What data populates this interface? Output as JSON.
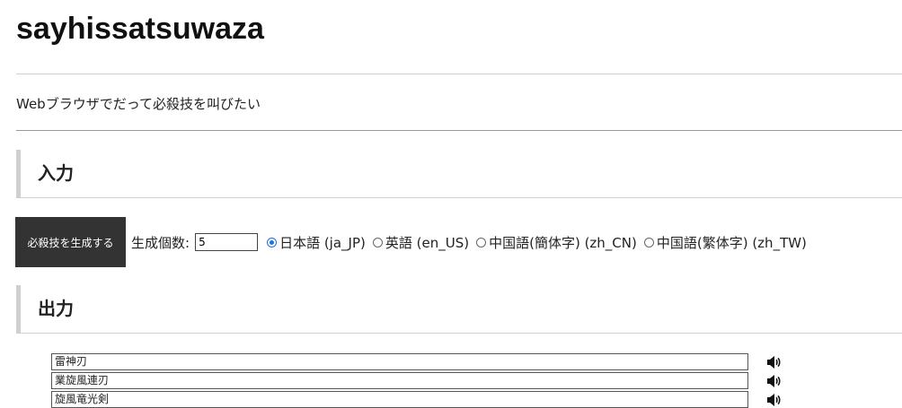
{
  "header": {
    "title": "sayhissatsuwaza",
    "tagline": "Webブラウザでだって必殺技を叫びたい"
  },
  "input_section": {
    "heading": "入力",
    "generate_button_label": "必殺技を生成する",
    "count_label": "生成個数:",
    "count_value": "5",
    "languages": [
      {
        "label": "日本語 (ja_JP)",
        "checked": true
      },
      {
        "label": "英語 (en_US)",
        "checked": false
      },
      {
        "label": "中国語(簡体字) (zh_CN)",
        "checked": false
      },
      {
        "label": "中国語(繁体字) (zh_TW)",
        "checked": false
      }
    ]
  },
  "output_section": {
    "heading": "出力",
    "results": [
      "雷神刃",
      "業旋風連刃",
      "旋風竜光剣"
    ],
    "speaker_icon": "speaker-icon"
  }
}
